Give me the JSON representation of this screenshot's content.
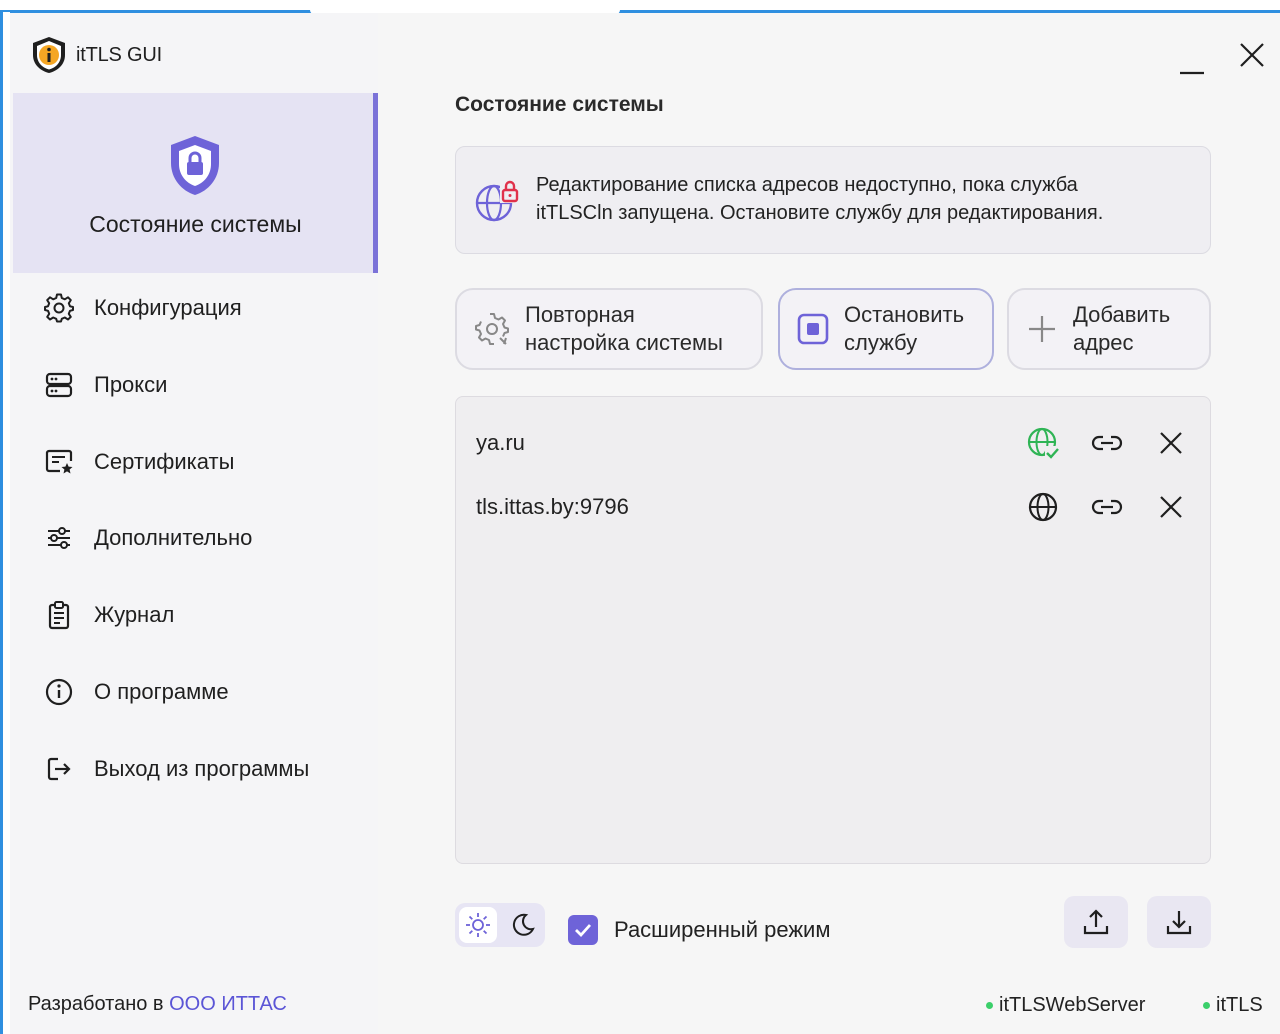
{
  "app": {
    "title": "itTLS GUI"
  },
  "sidebar": {
    "active": {
      "label": "Состояние системы"
    },
    "items": [
      {
        "label": "Конфигурация",
        "icon": "gear-icon"
      },
      {
        "label": "Прокси",
        "icon": "server-icon"
      },
      {
        "label": "Сертификаты",
        "icon": "certificate-icon"
      },
      {
        "label": "Дополнительно",
        "icon": "sliders-icon"
      },
      {
        "label": "Журнал",
        "icon": "clipboard-icon"
      },
      {
        "label": "О программе",
        "icon": "info-icon"
      },
      {
        "label": "Выход из программы",
        "icon": "exit-icon"
      }
    ],
    "footer": {
      "prefix": "Разработано в",
      "company": "ООО ИТТАС"
    }
  },
  "main": {
    "title": "Состояние системы",
    "warning": {
      "line1": "Редактирование списка адресов недоступно, пока служба",
      "line2": "itTLSCln запущена. Остановите службу для редактирования."
    },
    "buttons": {
      "reconfigure": {
        "line1": "Повторная",
        "line2": "настройка системы"
      },
      "stop": {
        "line1": "Остановить",
        "line2": "службу"
      },
      "add": {
        "line1": "Добавить",
        "line2": "адрес"
      }
    },
    "addresses": [
      {
        "address": "ya.ru",
        "globe_status": "active",
        "globe_color": "#2fb455"
      },
      {
        "address": "tls.ittas.by:9796",
        "globe_status": "inactive",
        "globe_color": "#1f1f1f"
      }
    ],
    "extended_mode": {
      "label": "Расширенный режим",
      "checked": true
    },
    "theme": {
      "selected": "light"
    }
  },
  "status_bar": {
    "services": [
      {
        "name": "itTLSWebServer",
        "color": "#3bcf6a"
      },
      {
        "name": "itTLS",
        "color": "#3bcf6a"
      }
    ]
  },
  "colors": {
    "accent": "#6e63d8",
    "sidebar_active": "#e5e3f3"
  }
}
